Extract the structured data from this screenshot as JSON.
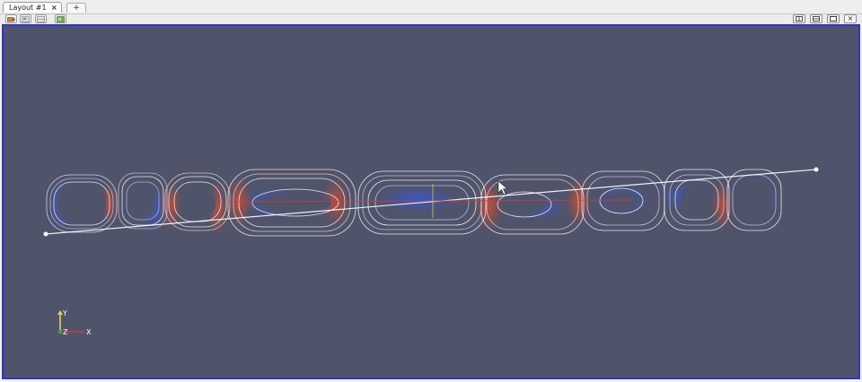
{
  "tabs": [
    {
      "label": "Layout #1",
      "close": "×"
    }
  ],
  "add_tab_label": "+",
  "toolbar": {
    "left_icons": [
      "camera-link-icon",
      "capture-icon",
      "split-view-icon",
      "camera-undo-icon"
    ],
    "right_buttons": [
      {
        "icon": "split-horizontal-icon"
      },
      {
        "icon": "split-vertical-icon"
      },
      {
        "icon": "maximize-icon"
      },
      {
        "icon": "close-icon",
        "label": "×"
      }
    ]
  },
  "viewport": {
    "background": "#50546b",
    "border_color": "#3333cc",
    "colormap": {
      "low": "#3b62d6",
      "mid": "#dcdce4",
      "high": "#d2492c"
    }
  },
  "axes": {
    "y_label": "Y",
    "z_label": "Z",
    "x_label": "X"
  }
}
